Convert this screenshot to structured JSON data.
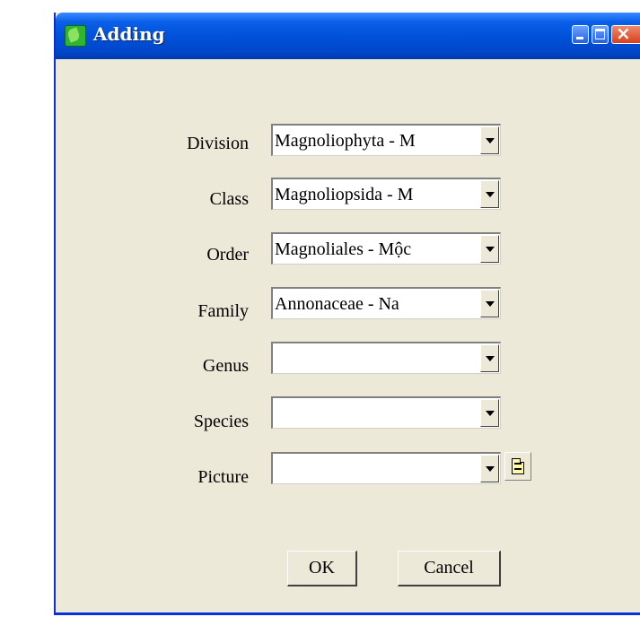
{
  "window": {
    "title": "Adding",
    "icon": "leaf-icon",
    "controls": [
      "minimize-icon",
      "maximize-icon",
      "close-icon"
    ]
  },
  "form": {
    "fields": [
      {
        "label": "Division",
        "value": "Magnoliophyta - M"
      },
      {
        "label": "Class",
        "value": "Magnoliopsida - M"
      },
      {
        "label": "Order",
        "value": "Magnoliales - Mộc"
      },
      {
        "label": "Family",
        "value": "Annonaceae - Na"
      },
      {
        "label": "Genus",
        "value": ""
      },
      {
        "label": "Species",
        "value": ""
      },
      {
        "label": "Picture",
        "value": ""
      }
    ],
    "browse_icon": "document-icon"
  },
  "buttons": {
    "ok": "OK",
    "cancel": "Cancel"
  },
  "colors": {
    "titlebar": "#0050d8",
    "dialog_bg": "#ece9d8",
    "close_button": "#d8401e"
  }
}
